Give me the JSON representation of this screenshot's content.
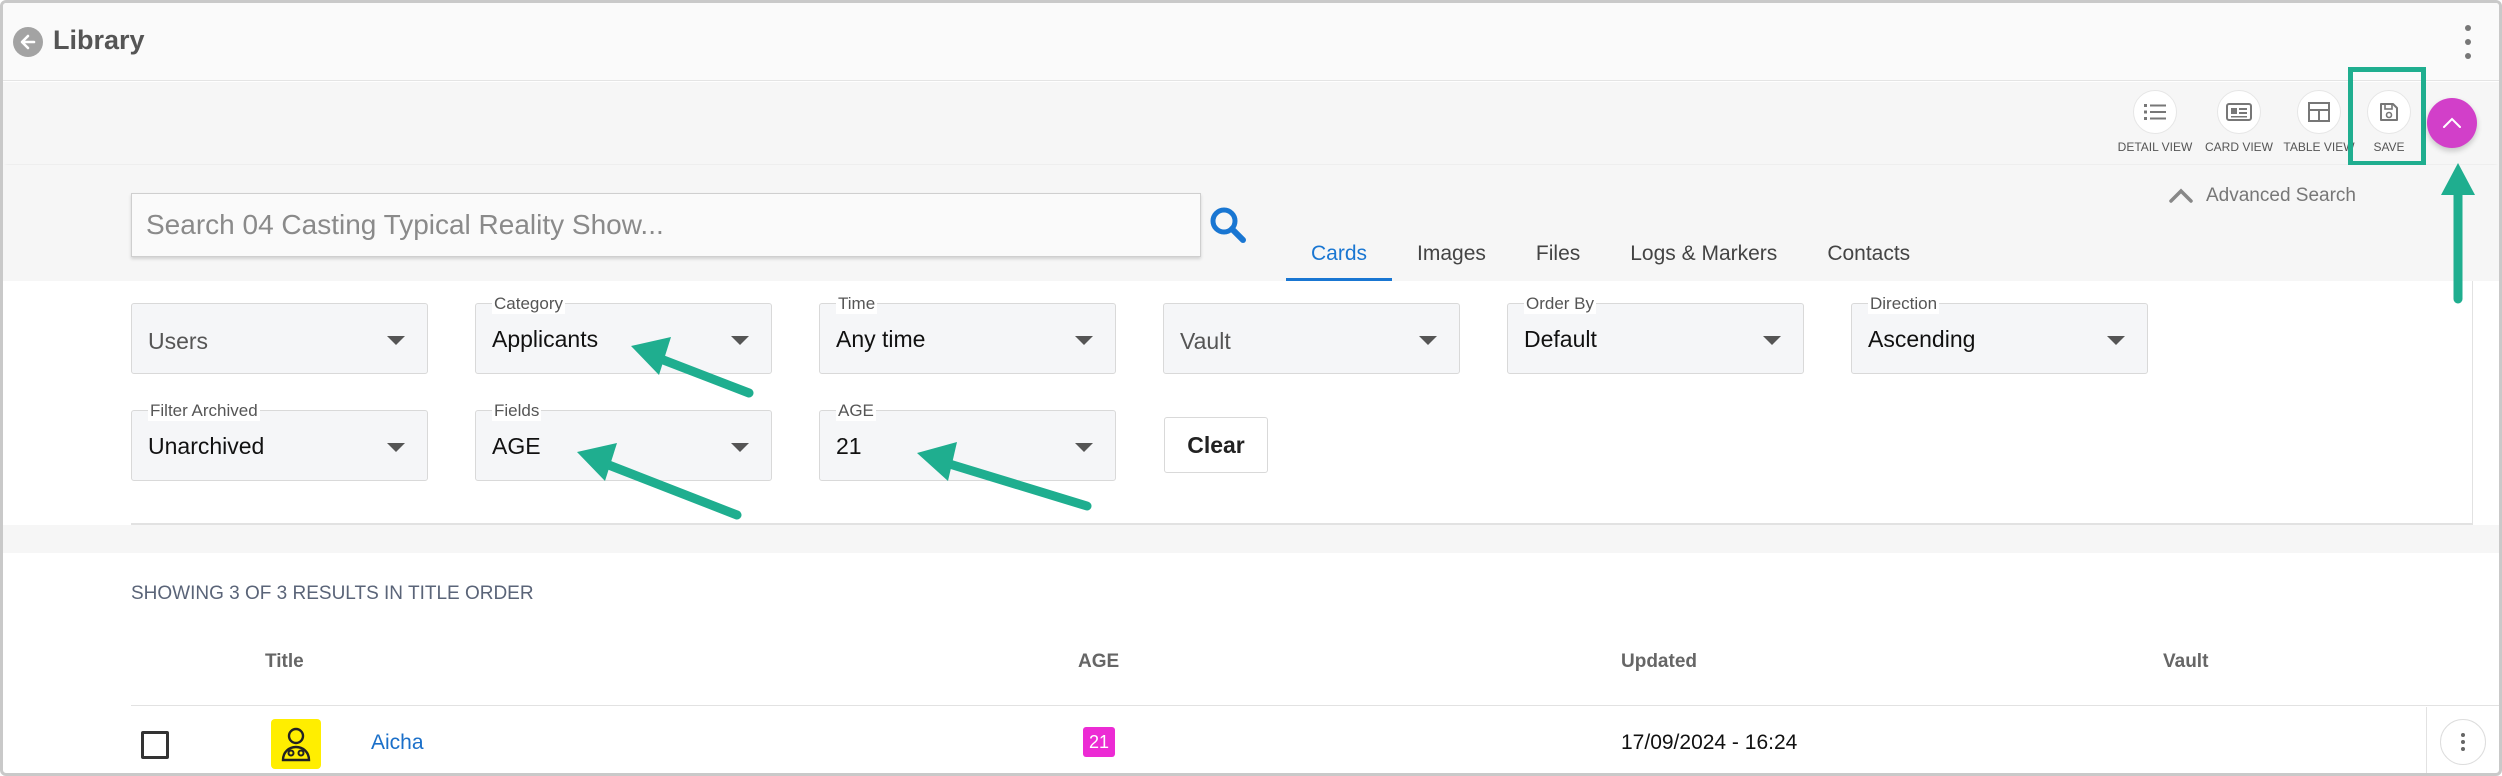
{
  "header": {
    "title": "Library"
  },
  "toolbar": {
    "views": [
      {
        "label": "DETAIL VIEW",
        "icon": "list-icon"
      },
      {
        "label": "CARD VIEW",
        "icon": "card-icon"
      },
      {
        "label": "TABLE VIEW",
        "icon": "table-icon"
      },
      {
        "label": "SAVE",
        "icon": "save-icon"
      }
    ]
  },
  "search": {
    "placeholder": "Search 04 Casting Typical Reality Show...",
    "advanced_label": "Advanced Search"
  },
  "tabs": [
    {
      "label": "Cards",
      "active": true
    },
    {
      "label": "Images"
    },
    {
      "label": "Files"
    },
    {
      "label": "Logs & Markers"
    },
    {
      "label": "Contacts"
    }
  ],
  "filters": {
    "users": {
      "label": "",
      "value": "Users"
    },
    "category": {
      "label": "Category",
      "value": "Applicants"
    },
    "time": {
      "label": "Time",
      "value": "Any time"
    },
    "vault": {
      "label": "",
      "value": "Vault"
    },
    "order_by": {
      "label": "Order By",
      "value": "Default"
    },
    "direction": {
      "label": "Direction",
      "value": "Ascending"
    },
    "filter_archived": {
      "label": "Filter Archived",
      "value": "Unarchived"
    },
    "fields": {
      "label": "Fields",
      "value": "AGE"
    },
    "age": {
      "label": "AGE",
      "value": "21"
    },
    "clear_label": "Clear"
  },
  "results": {
    "summary": "SHOWING 3 OF 3 RESULTS IN TITLE ORDER"
  },
  "table": {
    "columns": {
      "title": "Title",
      "age": "AGE",
      "updated": "Updated",
      "vault": "Vault"
    },
    "rows": [
      {
        "title": "Aicha",
        "age": "21",
        "updated": "17/09/2024 - 16:24",
        "vault": ""
      }
    ]
  },
  "colors": {
    "accent": "#1976d2",
    "fab": "#d23fc9",
    "annotation": "#1fae8f",
    "badge": "#ec2bd4",
    "avatar": "#ffee00"
  }
}
